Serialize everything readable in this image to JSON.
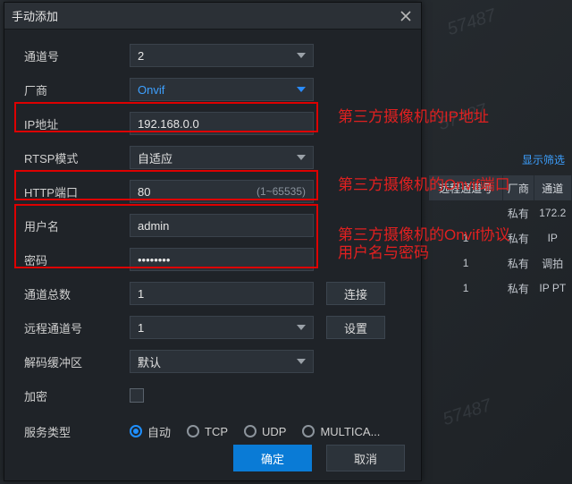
{
  "dialog": {
    "title": "手动添加",
    "rows": {
      "channel_label": "通道号",
      "channel_value": "2",
      "vendor_label": "厂商",
      "vendor_value": "Onvif",
      "ip_label": "IP地址",
      "ip_value": "192.168.0.0",
      "rtsp_label": "RTSP模式",
      "rtsp_value": "自适应",
      "http_label": "HTTP端口",
      "http_value": "80",
      "http_hint": "(1~65535)",
      "user_label": "用户名",
      "user_value": "admin",
      "pwd_label": "密码",
      "pwd_value": "••••••••",
      "total_label": "通道总数",
      "total_value": "1",
      "connect_btn": "连接",
      "remote_label": "远程通道号",
      "remote_value": "1",
      "set_btn": "设置",
      "buffer_label": "解码缓冲区",
      "buffer_value": "默认",
      "encrypt_label": "加密",
      "service_label": "服务类型"
    },
    "radios": [
      "自动",
      "TCP",
      "UDP",
      "MULTICA..."
    ],
    "ok": "确定",
    "cancel": "取消"
  },
  "annotations": {
    "ip": "第三方摄像机的IP地址",
    "port": "第三方摄像机的Onvif端口",
    "cred1": "第三方摄像机的Onvif协议",
    "cred2": "用户名与密码"
  },
  "bg": {
    "filter": "显示筛选",
    "headers": [
      "远程通道号",
      "厂商",
      "通道"
    ],
    "rows": [
      [
        "",
        "私有",
        "172.2"
      ],
      [
        "1",
        "私有",
        "IP"
      ],
      [
        "1",
        "私有",
        "调拍"
      ],
      [
        "1",
        "私有",
        "IP PT"
      ]
    ]
  },
  "watermark": "57487"
}
